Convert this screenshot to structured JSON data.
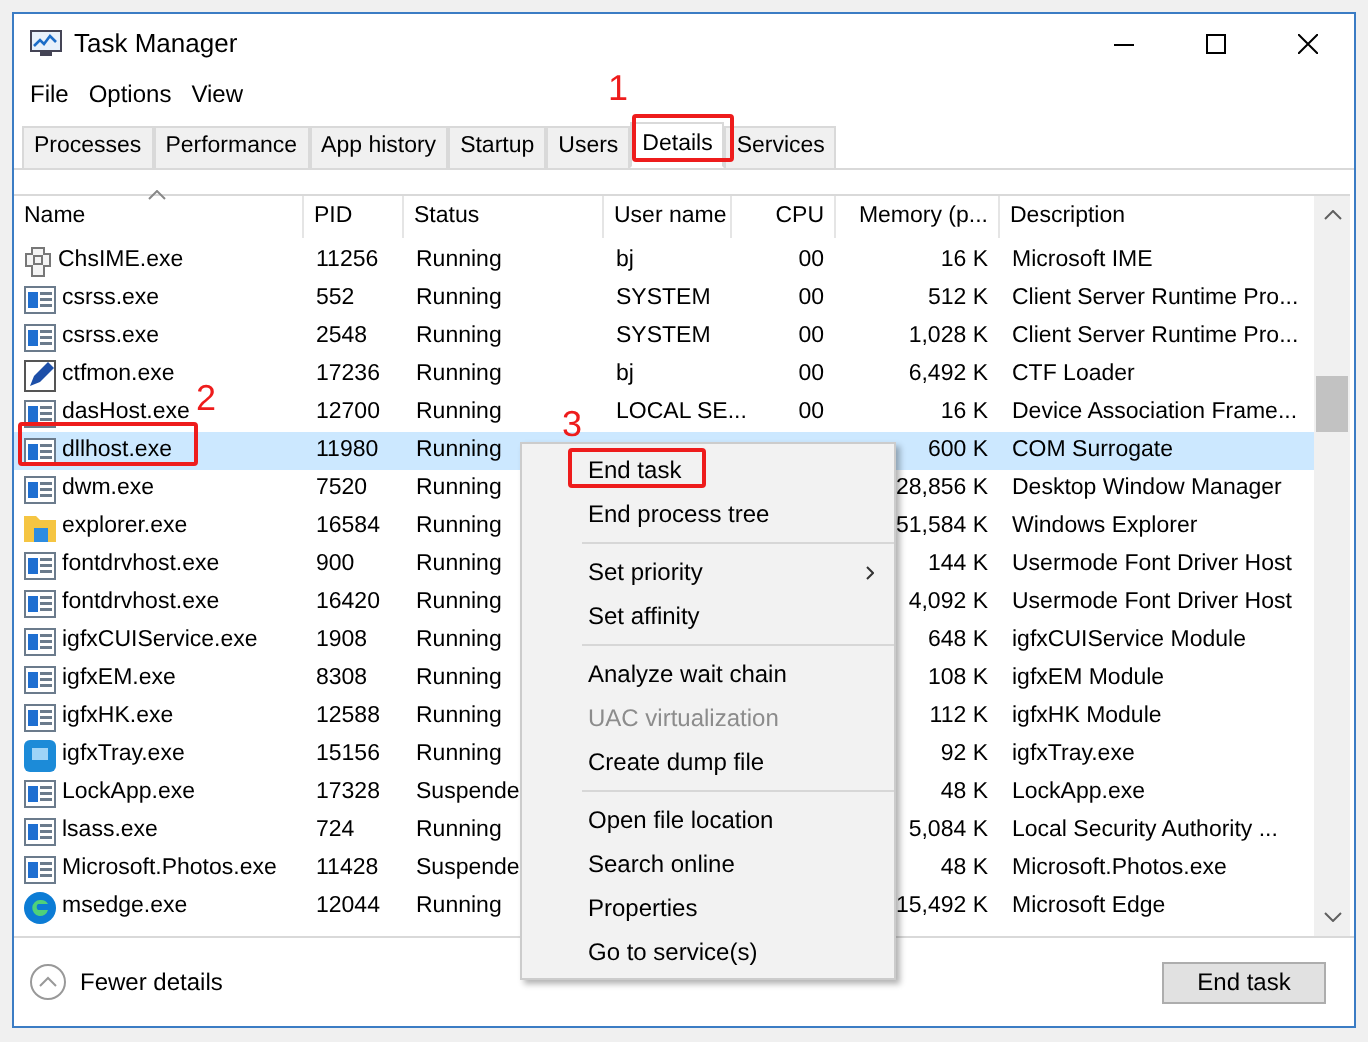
{
  "window": {
    "title": "Task Manager"
  },
  "menu_bar": [
    "File",
    "Options",
    "View"
  ],
  "tabs": [
    {
      "label": "Processes",
      "selected": false
    },
    {
      "label": "Performance",
      "selected": false
    },
    {
      "label": "App history",
      "selected": false
    },
    {
      "label": "Startup",
      "selected": false
    },
    {
      "label": "Users",
      "selected": false
    },
    {
      "label": "Details",
      "selected": true
    },
    {
      "label": "Services",
      "selected": false
    }
  ],
  "table": {
    "columns": [
      "Name",
      "PID",
      "Status",
      "User name",
      "CPU",
      "Memory (p...",
      "Description"
    ],
    "rows": [
      {
        "kind": "ime",
        "name": "ChsIME.exe",
        "pid": "11256",
        "status": "Running",
        "user": "bj",
        "cpu": "00",
        "memory": "16 K",
        "description": "Microsoft IME",
        "selected": false
      },
      {
        "kind": "app",
        "name": "csrss.exe",
        "pid": "552",
        "status": "Running",
        "user": "SYSTEM",
        "cpu": "00",
        "memory": "512 K",
        "description": "Client Server Runtime Pro...",
        "selected": false
      },
      {
        "kind": "app",
        "name": "csrss.exe",
        "pid": "2548",
        "status": "Running",
        "user": "SYSTEM",
        "cpu": "00",
        "memory": "1,028 K",
        "description": "Client Server Runtime Pro...",
        "selected": false
      },
      {
        "kind": "pen",
        "name": "ctfmon.exe",
        "pid": "17236",
        "status": "Running",
        "user": "bj",
        "cpu": "00",
        "memory": "6,492 K",
        "description": "CTF Loader",
        "selected": false
      },
      {
        "kind": "app",
        "name": "dasHost.exe",
        "pid": "12700",
        "status": "Running",
        "user": "LOCAL SE...",
        "cpu": "00",
        "memory": "16 K",
        "description": "Device Association Frame...",
        "selected": false
      },
      {
        "kind": "app",
        "name": "dllhost.exe",
        "pid": "11980",
        "status": "Running",
        "memory": "600 K",
        "description": "COM Surrogate",
        "selected": true
      },
      {
        "kind": "app",
        "name": "dwm.exe",
        "pid": "7520",
        "status": "Running",
        "memory": "28,856 K",
        "description": "Desktop Window Manager",
        "selected": false
      },
      {
        "kind": "folder",
        "name": "explorer.exe",
        "pid": "16584",
        "status": "Running",
        "memory": "51,584 K",
        "description": "Windows Explorer",
        "selected": false
      },
      {
        "kind": "app",
        "name": "fontdrvhost.exe",
        "pid": "900",
        "status": "Running",
        "memory": "144 K",
        "description": "Usermode Font Driver Host",
        "selected": false
      },
      {
        "kind": "app",
        "name": "fontdrvhost.exe",
        "pid": "16420",
        "status": "Running",
        "memory": "4,092 K",
        "description": "Usermode Font Driver Host",
        "selected": false
      },
      {
        "kind": "app",
        "name": "igfxCUIService.exe",
        "pid": "1908",
        "status": "Running",
        "memory": "648 K",
        "description": "igfxCUIService Module",
        "selected": false
      },
      {
        "kind": "app",
        "name": "igfxEM.exe",
        "pid": "8308",
        "status": "Running",
        "memory": "108 K",
        "description": "igfxEM Module",
        "selected": false
      },
      {
        "kind": "app",
        "name": "igfxHK.exe",
        "pid": "12588",
        "status": "Running",
        "memory": "112 K",
        "description": "igfxHK Module",
        "selected": false
      },
      {
        "kind": "tray",
        "name": "igfxTray.exe",
        "pid": "15156",
        "status": "Running",
        "memory": "92 K",
        "description": "igfxTray.exe",
        "selected": false
      },
      {
        "kind": "app",
        "name": "LockApp.exe",
        "pid": "17328",
        "status": "Suspende",
        "memory": "48 K",
        "description": "LockApp.exe",
        "selected": false
      },
      {
        "kind": "app",
        "name": "lsass.exe",
        "pid": "724",
        "status": "Running",
        "memory": "5,084 K",
        "description": "Local Security Authority ...",
        "selected": false
      },
      {
        "kind": "app",
        "name": "Microsoft.Photos.exe",
        "pid": "11428",
        "status": "Suspende",
        "memory": "48 K",
        "description": "Microsoft.Photos.exe",
        "selected": false
      },
      {
        "kind": "edge",
        "name": "msedge.exe",
        "pid": "12044",
        "status": "Running",
        "memory": "15,492 K",
        "description": "Microsoft Edge",
        "selected": false
      }
    ]
  },
  "context_menu": [
    [
      {
        "label": "End task",
        "disabled": false,
        "submenu": false
      },
      {
        "label": "End process tree",
        "disabled": false,
        "submenu": false
      }
    ],
    [
      {
        "label": "Set priority",
        "disabled": false,
        "submenu": true
      },
      {
        "label": "Set affinity",
        "disabled": false,
        "submenu": false
      }
    ],
    [
      {
        "label": "Analyze wait chain",
        "disabled": false,
        "submenu": false
      },
      {
        "label": "UAC virtualization",
        "disabled": true,
        "submenu": false
      },
      {
        "label": "Create dump file",
        "disabled": false,
        "submenu": false
      }
    ],
    [
      {
        "label": "Open file location",
        "disabled": false,
        "submenu": false
      },
      {
        "label": "Search online",
        "disabled": false,
        "submenu": false
      },
      {
        "label": "Properties",
        "disabled": false,
        "submenu": false
      },
      {
        "label": "Go to service(s)",
        "disabled": false,
        "submenu": false
      }
    ]
  ],
  "footer": {
    "fewer_details": "Fewer details",
    "end_task": "End task"
  },
  "annotations": [
    "1",
    "2",
    "3"
  ]
}
